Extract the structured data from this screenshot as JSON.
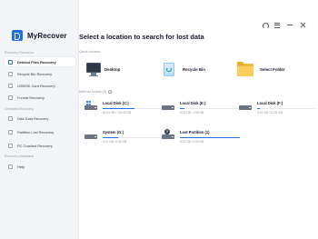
{
  "app": {
    "name": "MyRecover"
  },
  "window_controls": [
    {
      "name": "support-headset-icon"
    },
    {
      "name": "menu-icon"
    },
    {
      "name": "minimize-icon"
    },
    {
      "name": "close-icon"
    }
  ],
  "sidebar": {
    "sections": [
      {
        "title": "Recovery Scenarios",
        "items": [
          {
            "label": "Deleted Files Recovery",
            "active": true
          },
          {
            "label": "Recycle Bin Recovery"
          },
          {
            "label": "USB/SD Card Recovery"
          },
          {
            "label": "Format Recovery"
          }
        ]
      },
      {
        "title": "Unrelated Recovery",
        "items": [
          {
            "label": "Disk Data Recovery"
          },
          {
            "label": "Partition Lost Recovery"
          },
          {
            "label": "PC Crashed Recovery"
          }
        ]
      },
      {
        "title": "Recovery Assistants",
        "items": [
          {
            "label": "Help"
          }
        ]
      }
    ]
  },
  "main": {
    "title": "Select a location to search for lost data",
    "quick_access_label": "Quick Access",
    "quick_access": [
      {
        "label": "Desktop",
        "icon": "desktop-icon"
      },
      {
        "label": "Recycle Bin",
        "icon": "recycle-bin-icon"
      },
      {
        "label": "Select Folder",
        "icon": "folder-icon"
      }
    ],
    "internal_label": "Internal Drives (5)",
    "drives": [
      {
        "name": "Local Disk (C:)",
        "size": "63.24 GB / 119.45 GB",
        "used_fraction": 0.53,
        "system": true
      },
      {
        "name": "Local Disk (E:)",
        "size": "0.13 GB / 1.95 GB",
        "used_fraction": 0.07
      },
      {
        "name": "Local Disk (F:)",
        "size": "0.12 GB / 31.25 GB",
        "used_fraction": 0.04
      },
      {
        "name": "System (G:)",
        "size": "0.12 GB / 0.49 GB",
        "used_fraction": 0.25
      },
      {
        "name": "Lost Partition (1)",
        "size": "0.02 GB / 0.00 GB",
        "used_fraction": 1.0,
        "lost": true
      }
    ]
  },
  "colors": {
    "accent": "#1f6fe5",
    "sidebar_bg": "#f2f4f7"
  }
}
